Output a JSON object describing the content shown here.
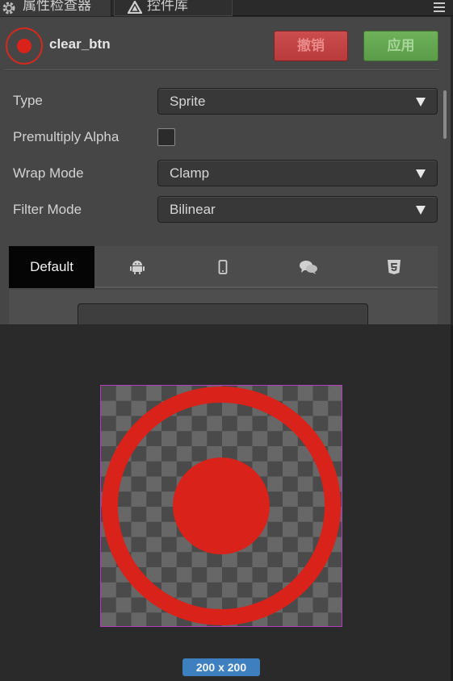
{
  "tabs": [
    {
      "label": "属性检查器",
      "icon": "gear-icon"
    },
    {
      "label": "控件库",
      "icon": "widget-library-icon"
    }
  ],
  "header": {
    "asset_name": "clear_btn",
    "revert_label": "撤销",
    "apply_label": "应用"
  },
  "properties": {
    "type_label": "Type",
    "type_value": "Sprite",
    "premultiply_label": "Premultiply Alpha",
    "premultiply_checked": false,
    "wrap_label": "Wrap Mode",
    "wrap_value": "Clamp",
    "filter_label": "Filter Mode",
    "filter_value": "Bilinear"
  },
  "platforms": {
    "default_label": "Default",
    "icons": [
      "android-icon",
      "phone-icon",
      "chat-icon",
      "html5-icon"
    ]
  },
  "preview": {
    "size_label": "200 x 200",
    "colors": {
      "accent_red": "#d8221a",
      "border": "#b53bbd",
      "badge": "#3d7fbf"
    }
  }
}
